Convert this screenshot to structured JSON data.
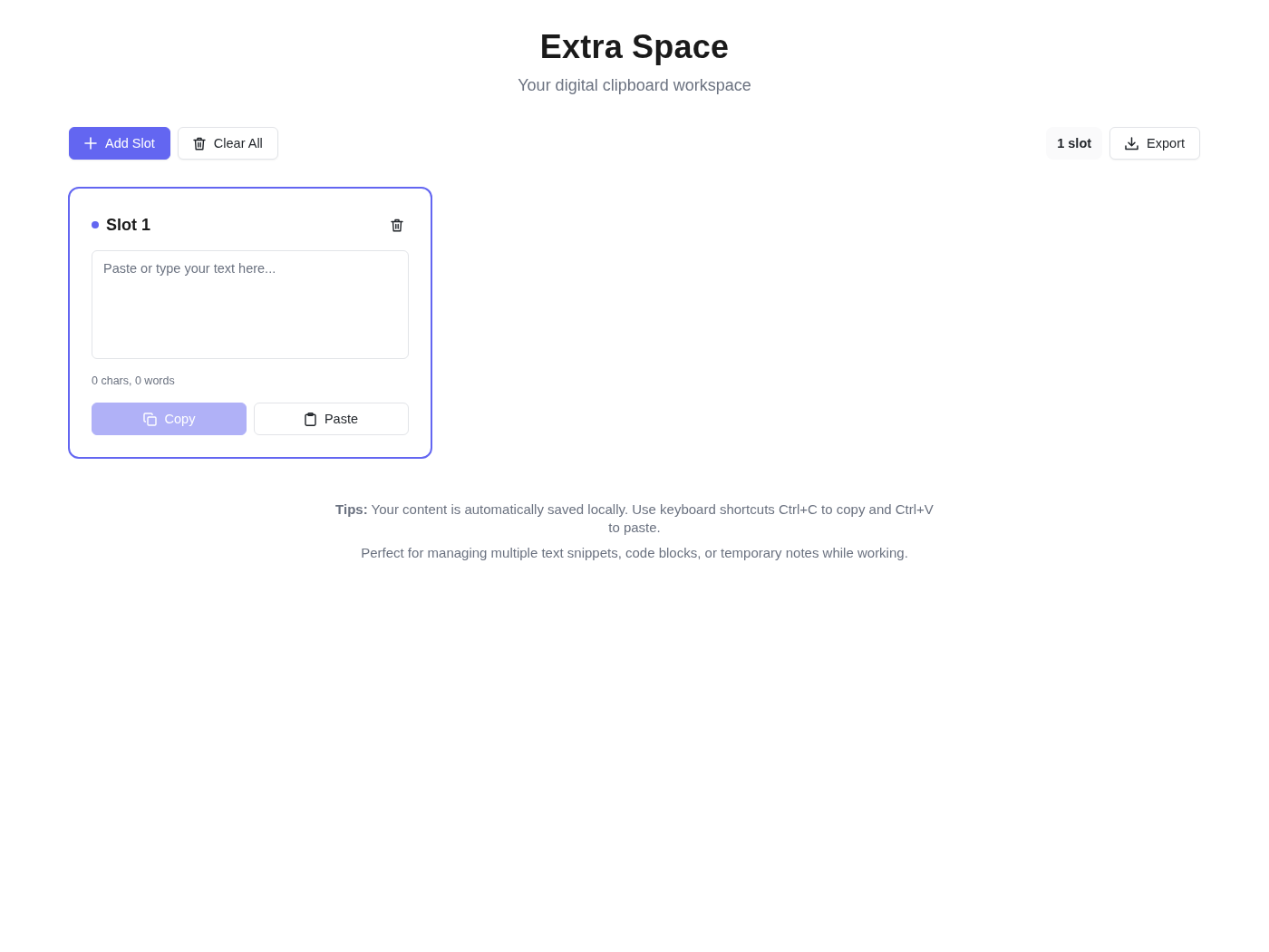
{
  "header": {
    "title": "Extra Space",
    "subtitle": "Your digital clipboard workspace"
  },
  "toolbar": {
    "add_button": {
      "label": "Add Slot"
    },
    "clear_button": {
      "label": "Clear All"
    },
    "slot_count": "1 slot",
    "export_button": {
      "label": "Export"
    }
  },
  "slots": [
    {
      "title": "Slot 1",
      "color": "#6366f1",
      "selected": true,
      "placeholder": "Paste or type your text here...",
      "stats": "0 chars, 0 words",
      "copy_button": {
        "label": "Copy",
        "disabled": true
      },
      "paste_button": {
        "label": "Paste",
        "disabled": false
      }
    }
  ],
  "tips": {
    "lines": [
      "**Tips:** Your content is automatically saved locally. Use keyboard shortcuts Ctrl+C to copy and Ctrl+V to paste.",
      "Perfect for managing multiple text snippets, code blocks, or temporary notes while working."
    ]
  }
}
